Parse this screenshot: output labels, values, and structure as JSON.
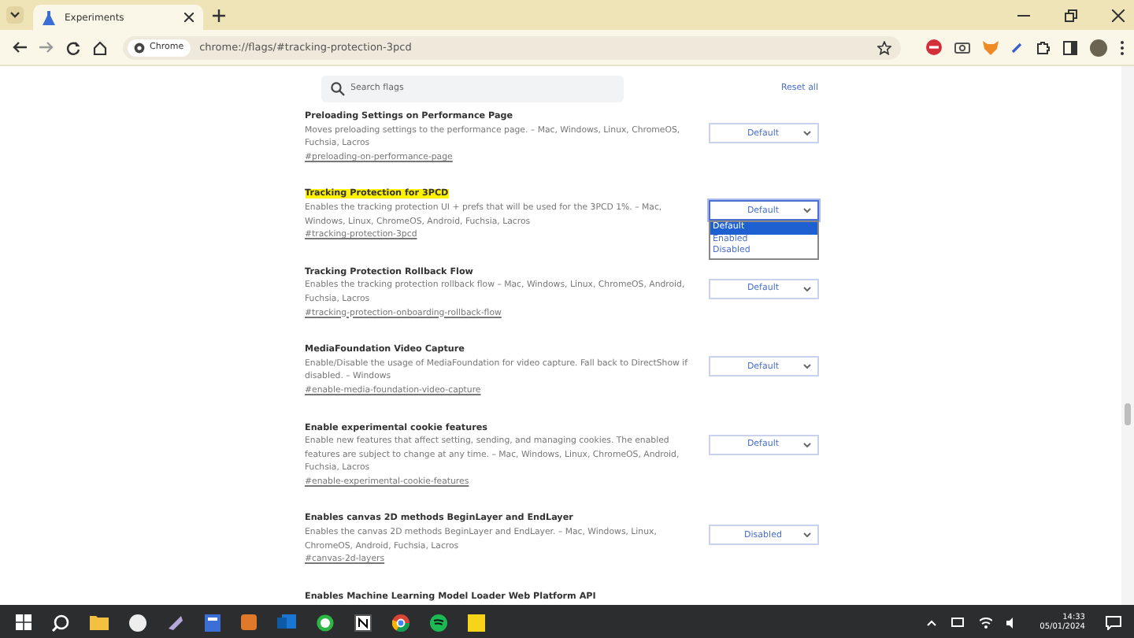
{
  "window": {
    "tab": {
      "title": "Experiments"
    },
    "address": {
      "chip": "Chrome",
      "url": "chrome://flags/#tracking-protection-3pcd"
    }
  },
  "search": {
    "placeholder": "Search flags"
  },
  "reset_button": "Reset all",
  "flags": [
    {
      "title": "Preloading Settings on Performance Page",
      "description": "Moves preloading settings to the performance page. – Mac, Windows, Linux, ChromeOS, Fuchsia, Lacros",
      "link": "#preloading-on-performance-page",
      "value": "Default",
      "highlighted": false,
      "expanded": false
    },
    {
      "title": "Tracking Protection for 3PCD",
      "description": "Enables the tracking protection UI + prefs that will be used for the 3PCD 1%. – Mac, Windows, Linux, ChromeOS, Android, Fuchsia, Lacros",
      "link": "#tracking-protection-3pcd",
      "value": "Default",
      "highlighted": true,
      "expanded": true,
      "options": [
        {
          "label": "Default",
          "selected": true
        },
        {
          "label": "Enabled",
          "selected": false
        },
        {
          "label": "Disabled",
          "selected": false
        }
      ]
    },
    {
      "title": "Tracking Protection Rollback Flow",
      "description": "Enables the tracking protection rollback flow – Mac, Windows, Linux, ChromeOS, Android, Fuchsia, Lacros",
      "link": "#tracking-protection-onboarding-rollback-flow",
      "value": "Default",
      "highlighted": false,
      "expanded": false
    },
    {
      "title": "MediaFoundation Video Capture",
      "description": "Enable/Disable the usage of MediaFoundation for video capture. Fall back to DirectShow if disabled. – Windows",
      "link": "#enable-media-foundation-video-capture",
      "value": "Default",
      "highlighted": false,
      "expanded": false
    },
    {
      "title": "Enable experimental cookie features",
      "description": "Enable new features that affect setting, sending, and managing cookies. The enabled features are subject to change at any time. – Mac, Windows, Linux, ChromeOS, Android, Fuchsia, Lacros",
      "link": "#enable-experimental-cookie-features",
      "value": "Default",
      "highlighted": false,
      "expanded": false
    },
    {
      "title": "Enables canvas 2D methods BeginLayer and EndLayer",
      "description": "Enables the canvas 2D methods BeginLayer and EndLayer. – Mac, Windows, Linux, ChromeOS, Android, Fuchsia, Lacros",
      "link": "#canvas-2d-layers",
      "value": "Disabled",
      "highlighted": false,
      "expanded": false
    },
    {
      "title": "Enables Machine Learning Model Loader Web Platform API",
      "highlighted": false
    }
  ],
  "clock": {
    "time": "14:33",
    "date": "05/01/2024"
  }
}
